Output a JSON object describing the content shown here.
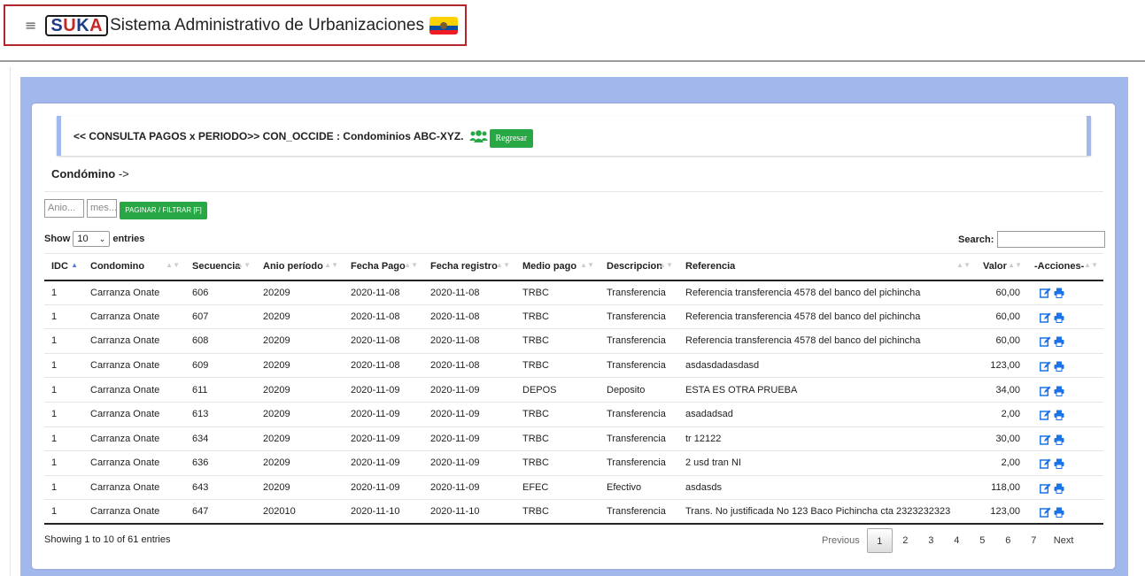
{
  "header": {
    "logo_text": "SUKA",
    "app_title": "Sistema Administrativo de Urbanizaciones",
    "accent": "#b3262e"
  },
  "callout": {
    "text": "<< CONSULTA PAGOS x PERIODO>> CON_OCCIDE : Condominios ABC-XYZ.",
    "back_button": "Regresar"
  },
  "condominio": {
    "label": "Condómino",
    "arrow": "->"
  },
  "filters": {
    "anio_placeholder": "Anio...",
    "mes_placeholder": "mes...",
    "filter_button": "PAGINAR / FILTRAR [F]"
  },
  "table_controls": {
    "show_label": "Show",
    "page_size": "10",
    "entries_label": "entries",
    "search_label": "Search:"
  },
  "table": {
    "columns": [
      "IDC",
      "Condomino",
      "Secuencia",
      "Anio período",
      "Fecha Pago",
      "Fecha registro",
      "Medio pago",
      "Descripcion",
      "Referencia",
      "Valor",
      "-Acciones-"
    ],
    "rows": [
      [
        "1",
        "Carranza Onate",
        "606",
        "20209",
        "2020-11-08",
        "2020-11-08",
        "TRBC",
        "Transferencia",
        "Referencia transferencia 4578 del banco del pichincha",
        "60,00"
      ],
      [
        "1",
        "Carranza Onate",
        "607",
        "20209",
        "2020-11-08",
        "2020-11-08",
        "TRBC",
        "Transferencia",
        "Referencia transferencia 4578 del banco del pichincha",
        "60,00"
      ],
      [
        "1",
        "Carranza Onate",
        "608",
        "20209",
        "2020-11-08",
        "2020-11-08",
        "TRBC",
        "Transferencia",
        "Referencia transferencia 4578 del banco del pichincha",
        "60,00"
      ],
      [
        "1",
        "Carranza Onate",
        "609",
        "20209",
        "2020-11-08",
        "2020-11-08",
        "TRBC",
        "Transferencia",
        "asdasdadasdasd",
        "123,00"
      ],
      [
        "1",
        "Carranza Onate",
        "611",
        "20209",
        "2020-11-09",
        "2020-11-09",
        "DEPOS",
        "Deposito",
        "ESTA ES OTRA PRUEBA",
        "34,00"
      ],
      [
        "1",
        "Carranza Onate",
        "613",
        "20209",
        "2020-11-09",
        "2020-11-09",
        "TRBC",
        "Transferencia",
        "asadadsad",
        "2,00"
      ],
      [
        "1",
        "Carranza Onate",
        "634",
        "20209",
        "2020-11-09",
        "2020-11-09",
        "TRBC",
        "Transferencia",
        "tr 12122",
        "30,00"
      ],
      [
        "1",
        "Carranza Onate",
        "636",
        "20209",
        "2020-11-09",
        "2020-11-09",
        "TRBC",
        "Transferencia",
        "2 usd tran NI",
        "2,00"
      ],
      [
        "1",
        "Carranza Onate",
        "643",
        "20209",
        "2020-11-09",
        "2020-11-09",
        "EFEC",
        "Efectivo",
        "asdasds",
        "118,00"
      ],
      [
        "1",
        "Carranza Onate",
        "647",
        "202010",
        "2020-11-10",
        "2020-11-10",
        "TRBC",
        "Transferencia",
        "Trans. No justificada No 123 Baco Pichincha cta 2323232323",
        "123,00"
      ]
    ]
  },
  "footer": {
    "info": "Showing 1 to 10 of 61 entries",
    "previous": "Previous",
    "pages": [
      "1",
      "2",
      "3",
      "4",
      "5",
      "6",
      "7"
    ],
    "next": "Next"
  }
}
